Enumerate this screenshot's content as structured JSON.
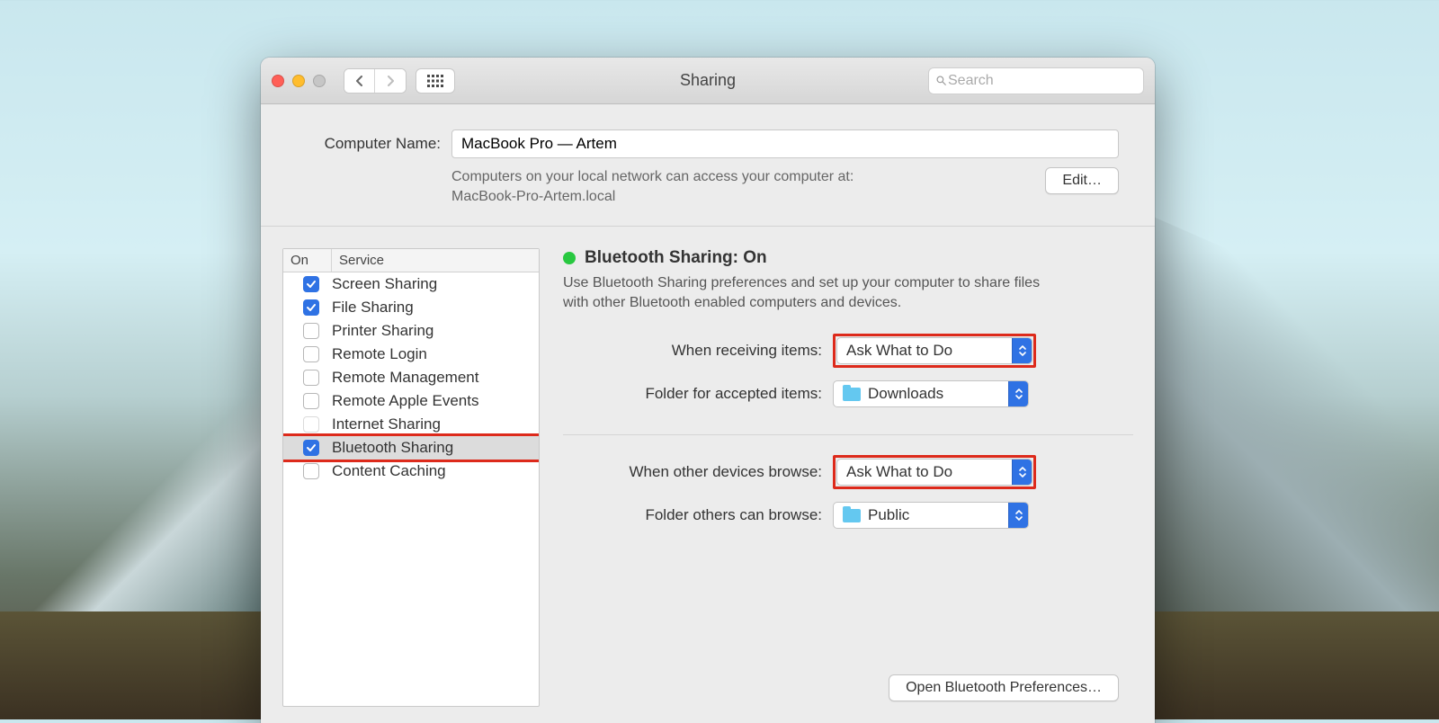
{
  "window": {
    "title": "Sharing",
    "search_placeholder": "Search"
  },
  "computer_name": {
    "label": "Computer Name:",
    "value": "MacBook Pro — Artem",
    "hint_line1": "Computers on your local network can access your computer at:",
    "hint_line2": "MacBook-Pro-Artem.local",
    "edit_button": "Edit…"
  },
  "services": {
    "col_on": "On",
    "col_service": "Service",
    "items": [
      {
        "label": "Screen Sharing",
        "checked": true,
        "selected": false,
        "highlighted": false
      },
      {
        "label": "File Sharing",
        "checked": true,
        "selected": false,
        "highlighted": false
      },
      {
        "label": "Printer Sharing",
        "checked": false,
        "selected": false,
        "highlighted": false
      },
      {
        "label": "Remote Login",
        "checked": false,
        "selected": false,
        "highlighted": false
      },
      {
        "label": "Remote Management",
        "checked": false,
        "selected": false,
        "highlighted": false
      },
      {
        "label": "Remote Apple Events",
        "checked": false,
        "selected": false,
        "highlighted": false
      },
      {
        "label": "Internet Sharing",
        "checked": false,
        "selected": false,
        "highlighted": false,
        "disabled": true
      },
      {
        "label": "Bluetooth Sharing",
        "checked": true,
        "selected": true,
        "highlighted": true
      },
      {
        "label": "Content Caching",
        "checked": false,
        "selected": false,
        "highlighted": false
      }
    ]
  },
  "detail": {
    "status_title": "Bluetooth Sharing: On",
    "description": "Use Bluetooth Sharing preferences and set up your computer to share files with other Bluetooth enabled computers and devices.",
    "rows": {
      "receiving_label": "When receiving items:",
      "receiving_value": "Ask What to Do",
      "accepted_folder_label": "Folder for accepted items:",
      "accepted_folder_value": "Downloads",
      "browse_label": "When other devices browse:",
      "browse_value": "Ask What to Do",
      "browse_folder_label": "Folder others can browse:",
      "browse_folder_value": "Public"
    },
    "open_prefs_button": "Open Bluetooth Preferences…"
  }
}
